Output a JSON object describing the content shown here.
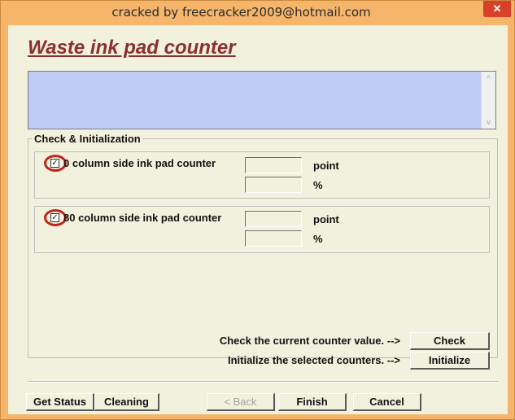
{
  "window": {
    "title": "cracked by freecracker2009@hotmail.com",
    "close_glyph": "✕"
  },
  "heading": "Waste ink pad counter",
  "info_box": {
    "text": "",
    "scroll_up_glyph": "^",
    "scroll_down_glyph": "v"
  },
  "check_init": {
    "group_title": "Check & Initialization",
    "counters": [
      {
        "label": "0 column side ink pad counter",
        "checked": true,
        "check_glyph": "☑",
        "point_value": "",
        "percent_value": "",
        "point_unit": "point",
        "percent_unit": "%"
      },
      {
        "label": "80 column side ink pad counter",
        "checked": true,
        "check_glyph": "☑",
        "point_value": "",
        "percent_value": "",
        "point_unit": "point",
        "percent_unit": "%"
      }
    ],
    "check_hint": "Check the current counter value. -->",
    "check_button": "Check",
    "init_hint": "Initialize the selected counters. -->",
    "init_button": "Initialize"
  },
  "footer": {
    "get_status": "Get Status",
    "cleaning": "Cleaning",
    "back": "< Back",
    "finish": "Finish",
    "cancel": "Cancel"
  },
  "colors": {
    "title_bar": "#f5b56b",
    "heading": "#8b2f2f",
    "info_box": "#bfcaf7",
    "highlight_ring": "#c0261d",
    "dialog_bg": "#f2f1de"
  }
}
